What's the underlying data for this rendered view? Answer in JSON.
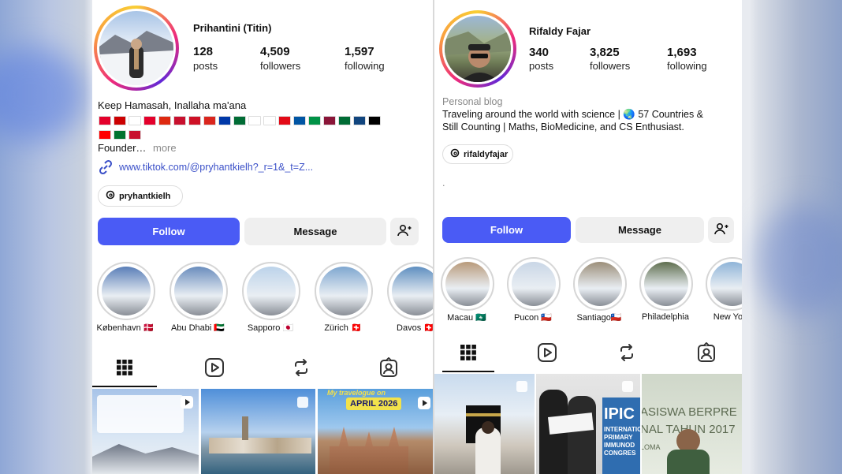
{
  "left_profile": {
    "name": "Prihantini (Titin)",
    "stats": {
      "posts_num": "128",
      "posts_lbl": "posts",
      "followers_num": "4,509",
      "followers_lbl": "followers",
      "following_num": "1,597",
      "following_lbl": "following"
    },
    "bio_line1": "Keep Hamasah, Inallaha ma'ana",
    "bio_founder": "Founder…",
    "bio_more": "more",
    "link": "www.tiktok.com/@pryhantkielh?_r=1&_t=Z...",
    "threads_handle": "pryhantkielh",
    "follow_label": "Follow",
    "message_label": "Message",
    "flags_row1": [
      "#e4002b",
      "#cc0001",
      "#ffffff",
      "#e4002b",
      "#de2910",
      "#c8102e",
      "#ce1126",
      "#da251d",
      "#0038a8",
      "#006c35",
      "#ffffff",
      "#ffffff",
      "#e30a17",
      "#0055a4",
      "#009246",
      "#8a1538",
      "#006c35",
      "#11457e",
      "#000000"
    ],
    "flags_row2": [
      "#ff0000",
      "#00732f",
      "#c8102e"
    ],
    "highlights": [
      {
        "label": "København 🇩🇰"
      },
      {
        "label": "Abu Dhabi 🇦🇪"
      },
      {
        "label": "Sapporo 🇯🇵"
      },
      {
        "label": "Zürich 🇨🇭"
      },
      {
        "label": "Davos 🇨🇭"
      }
    ],
    "post3_banner": "My travelogue on",
    "post3_date": "APRIL 2026"
  },
  "right_profile": {
    "name": "Rifaldy Fajar",
    "stats": {
      "posts_num": "340",
      "posts_lbl": "posts",
      "followers_num": "3,825",
      "followers_lbl": "followers",
      "following_num": "1,693",
      "following_lbl": "following"
    },
    "category": "Personal blog",
    "bio_line1": "Traveling around the world with science | 🌏 57 Countries &",
    "bio_line2": "Still Counting | Maths, BioMedicine, and CS Enthusiast.",
    "threads_handle": "rifaldyfajar",
    "dot": ".",
    "follow_label": "Follow",
    "message_label": "Message",
    "highlights": [
      {
        "label": "Macau 🇲🇴"
      },
      {
        "label": "Pucon 🇨🇱"
      },
      {
        "label": "Santiago🇨🇱"
      },
      {
        "label": "Philadelphia"
      },
      {
        "label": "New York"
      }
    ],
    "post2_text": "IPIC",
    "post2_sub1": "INTERNATIONAL",
    "post2_sub2": "PRIMARY",
    "post2_sub3": "IMMUNOD",
    "post2_sub4": "CONGRES",
    "post3_text1": "ASISWA BERPRE",
    "post3_text2": "NAL TAHUN 2017",
    "post3_text3": "LOMA"
  }
}
